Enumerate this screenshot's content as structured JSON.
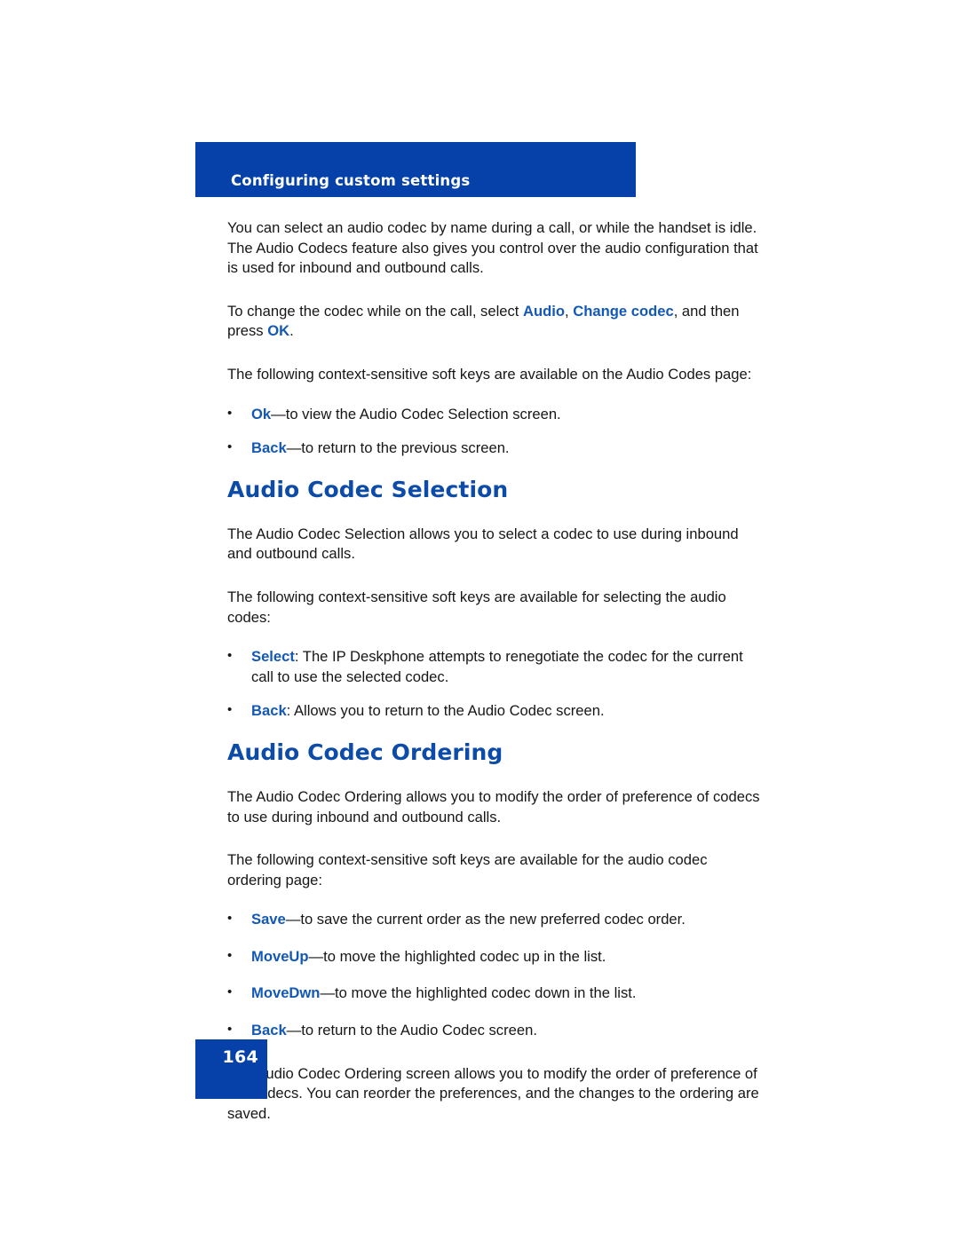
{
  "document": {
    "running_header": "Configuring custom settings",
    "page_number": "164",
    "accent_blue": "#0541A9",
    "heading_blue": "#0D4BA8",
    "term_blue": "#1358B5"
  },
  "content": {
    "para_1": "You can select an audio codec by name during a call, or while the handset is idle. The Audio Codecs feature also gives you control over the audio configuration that is used for inbound and outbound calls.",
    "para_2": {
      "part_1": "To change the codec while on the call, select ",
      "term_1": "Audio",
      "part_2": ", ",
      "term_2": "Change codec",
      "part_3": ", and then press ",
      "term_3": "OK",
      "part_4": "."
    },
    "para_3": "The following context-sensitive soft keys are available on the Audio Codes page:",
    "list_1": {
      "bullet_glyph": "•",
      "items": [
        {
          "term": "Ok",
          "rest": "—to view the Audio Codec Selection screen."
        },
        {
          "term": "Back",
          "rest": "—to return to the previous screen."
        }
      ]
    },
    "heading_1": "Audio Codec Selection",
    "para_4": "The Audio Codec Selection allows you to select a codec to use during inbound and outbound calls.",
    "para_5": "The following context-sensitive soft keys are available for selecting the audio codes:",
    "list_2": {
      "bullet_glyph": "•",
      "items": [
        {
          "term": "Select",
          "rest": ": The IP Deskphone attempts to renegotiate the codec for the current call to use the selected codec."
        },
        {
          "term": "Back",
          "rest": ": Allows you to return to the Audio Codec screen."
        }
      ]
    },
    "heading_2": "Audio Codec Ordering",
    "para_6": "The Audio Codec Ordering allows you to modify the order of preference of codecs to use during inbound and outbound calls.",
    "para_7": "The following context-sensitive soft keys are available for the audio codec ordering page:",
    "list_3": {
      "bullet_glyph": "•",
      "items": [
        {
          "term": "Save",
          "rest": "—to save the current order as the new preferred codec order."
        },
        {
          "term": "MoveUp",
          "rest": "—to move the highlighted codec up in the list."
        },
        {
          "term": "MoveDwn",
          "rest": "—to move the highlighted codec down in the list."
        },
        {
          "term": "Back",
          "rest": "—to return to the Audio Codec screen."
        }
      ]
    },
    "para_8": "The Audio Codec Ordering screen allows you to modify the order of preference of the codecs. You can reorder the preferences, and the changes to the ordering are saved."
  }
}
